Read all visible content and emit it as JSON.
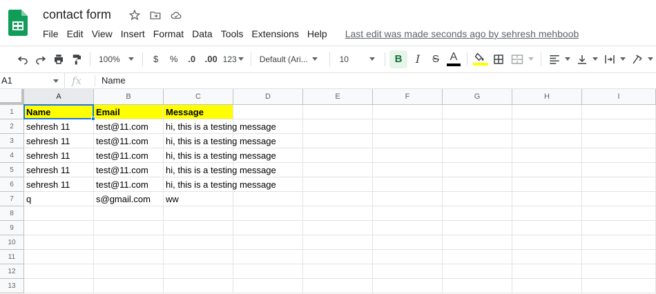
{
  "app": {
    "doc_title": "contact form",
    "last_edit": "Last edit was made seconds ago by sehresh mehboob"
  },
  "menu": [
    "File",
    "Edit",
    "View",
    "Insert",
    "Format",
    "Data",
    "Tools",
    "Extensions",
    "Help"
  ],
  "toolbar": {
    "zoom": "100%",
    "currency": "$",
    "percent": "%",
    "decrease_decimal": ".0",
    "increase_decimal": ".00",
    "more_formats": "123",
    "font": "Default (Ari...",
    "font_size": "10",
    "bold": "B",
    "italic": "I",
    "strikethrough": "S",
    "text_color_letter": "A",
    "text_color": "#000000",
    "fill_color": "#ffff00"
  },
  "formula_bar": {
    "name_box": "A1",
    "fx": "fx",
    "content": "Name"
  },
  "sheet": {
    "columns": [
      "A",
      "B",
      "C",
      "D",
      "E",
      "F",
      "G",
      "H",
      "I"
    ],
    "row_numbers": [
      "1",
      "2",
      "3",
      "4",
      "5",
      "6",
      "7",
      "8",
      "9",
      "10",
      "11",
      "12",
      "13"
    ],
    "header_row": [
      "Name",
      "Email",
      "Message"
    ],
    "rows": [
      [
        "sehresh 11",
        "test@11.com",
        "hi, this is a testing message"
      ],
      [
        "sehresh 11",
        "test@11.com",
        "hi, this is a testing message"
      ],
      [
        "sehresh 11",
        "test@11.com",
        "hi, this is a testing message"
      ],
      [
        "sehresh 11",
        "test@11.com",
        "hi, this is a testing message"
      ],
      [
        "sehresh 11",
        "test@11.com",
        "hi, this is a testing message"
      ],
      [
        "q",
        "s@gmail.com",
        "ww"
      ]
    ],
    "header_fill": "#ffff00",
    "selected_cell": "A1"
  }
}
